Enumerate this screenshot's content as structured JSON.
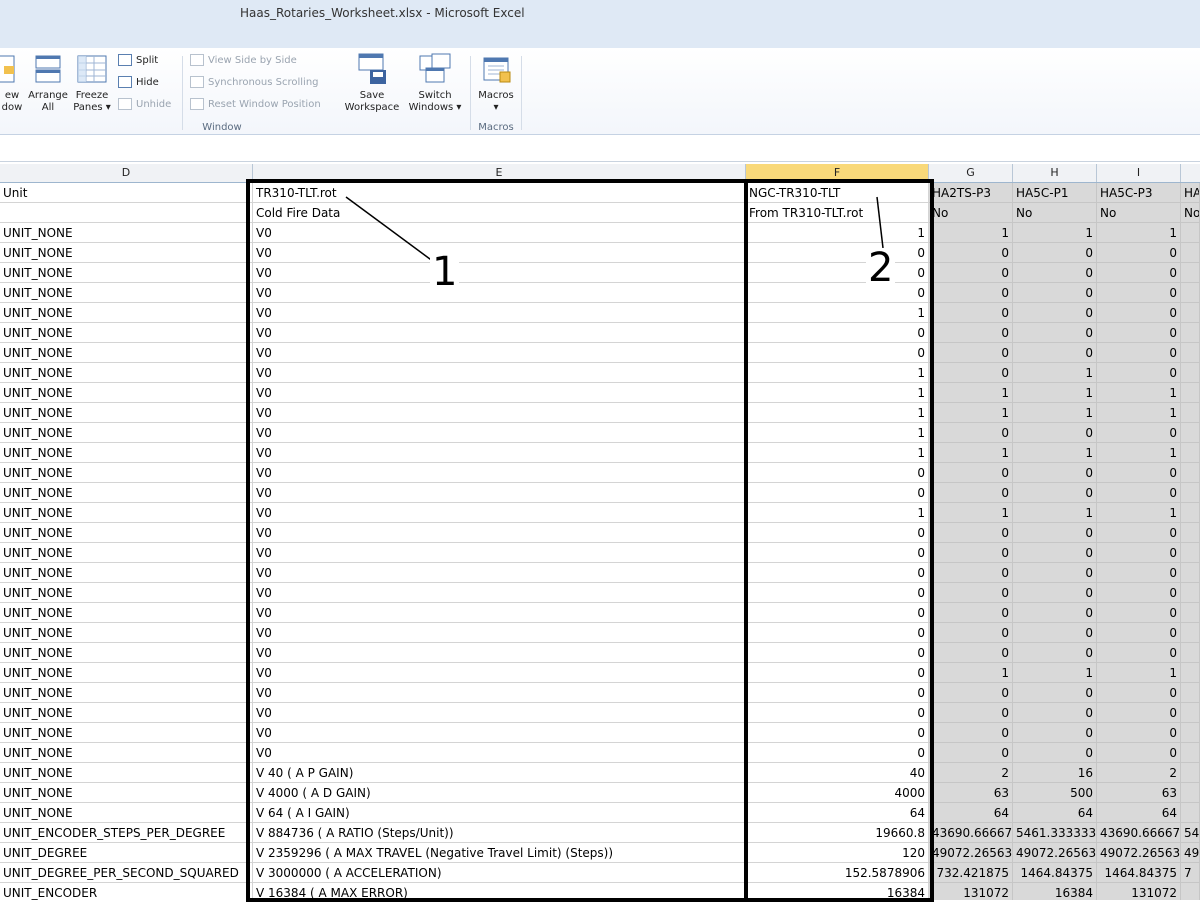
{
  "window": {
    "title": "Haas_Rotaries_Worksheet.xlsx  -  Microsoft Excel"
  },
  "ribbon": {
    "new_window": "ew\ndow",
    "arrange_all": "Arrange\nAll",
    "freeze_panes": "Freeze\nPanes ▾",
    "split": "Split",
    "hide": "Hide",
    "unhide": "Unhide",
    "view_side_by_side": "View Side by Side",
    "synchronous_scrolling": "Synchronous Scrolling",
    "reset_window_position": "Reset Window Position",
    "save_workspace": "Save\nWorkspace",
    "switch_windows": "Switch\nWindows ▾",
    "macros": "Macros",
    "macros_arrow": "▾",
    "group_window": "Window",
    "group_macros": "Macros"
  },
  "columns": [
    "D",
    "E",
    "F",
    "G",
    "H",
    "I"
  ],
  "selected_column": "F",
  "annotations": {
    "callout1": "1",
    "callout2": "2"
  },
  "header_rows": [
    {
      "d": "Unit",
      "e": "TR310-TLT.rot",
      "f": "NGC-TR310-TLT",
      "g": "HA2TS-P3",
      "h": "HA5C-P1",
      "i": "HA5C-P3",
      "j": "HA"
    },
    {
      "d": "",
      "e": "Cold Fire Data",
      "f": "From TR310-TLT.rot",
      "g": "No",
      "h": "No",
      "i": "No",
      "j": "No"
    }
  ],
  "rows": [
    {
      "d": "UNIT_NONE",
      "e": "V0",
      "f": "1",
      "g": "1",
      "h": "1",
      "i": "1"
    },
    {
      "d": "UNIT_NONE",
      "e": "V0",
      "f": "0",
      "g": "0",
      "h": "0",
      "i": "0"
    },
    {
      "d": "UNIT_NONE",
      "e": "V0",
      "f": "0",
      "g": "0",
      "h": "0",
      "i": "0"
    },
    {
      "d": "UNIT_NONE",
      "e": "V0",
      "f": "0",
      "g": "0",
      "h": "0",
      "i": "0"
    },
    {
      "d": "UNIT_NONE",
      "e": "V0",
      "f": "1",
      "g": "0",
      "h": "0",
      "i": "0"
    },
    {
      "d": "UNIT_NONE",
      "e": "V0",
      "f": "0",
      "g": "0",
      "h": "0",
      "i": "0"
    },
    {
      "d": "UNIT_NONE",
      "e": "V0",
      "f": "0",
      "g": "0",
      "h": "0",
      "i": "0"
    },
    {
      "d": "UNIT_NONE",
      "e": "V0",
      "f": "1",
      "g": "0",
      "h": "1",
      "i": "0"
    },
    {
      "d": "UNIT_NONE",
      "e": "V0",
      "f": "1",
      "g": "1",
      "h": "1",
      "i": "1"
    },
    {
      "d": "UNIT_NONE",
      "e": "V0",
      "f": "1",
      "g": "1",
      "h": "1",
      "i": "1"
    },
    {
      "d": "UNIT_NONE",
      "e": "V0",
      "f": "1",
      "g": "0",
      "h": "0",
      "i": "0"
    },
    {
      "d": "UNIT_NONE",
      "e": "V0",
      "f": "1",
      "g": "1",
      "h": "1",
      "i": "1"
    },
    {
      "d": "UNIT_NONE",
      "e": "V0",
      "f": "0",
      "g": "0",
      "h": "0",
      "i": "0"
    },
    {
      "d": "UNIT_NONE",
      "e": "V0",
      "f": "0",
      "g": "0",
      "h": "0",
      "i": "0"
    },
    {
      "d": "UNIT_NONE",
      "e": "V0",
      "f": "1",
      "g": "1",
      "h": "1",
      "i": "1"
    },
    {
      "d": "UNIT_NONE",
      "e": "V0",
      "f": "0",
      "g": "0",
      "h": "0",
      "i": "0"
    },
    {
      "d": "UNIT_NONE",
      "e": "V0",
      "f": "0",
      "g": "0",
      "h": "0",
      "i": "0"
    },
    {
      "d": "UNIT_NONE",
      "e": "V0",
      "f": "0",
      "g": "0",
      "h": "0",
      "i": "0"
    },
    {
      "d": "UNIT_NONE",
      "e": "V0",
      "f": "0",
      "g": "0",
      "h": "0",
      "i": "0"
    },
    {
      "d": "UNIT_NONE",
      "e": "V0",
      "f": "0",
      "g": "0",
      "h": "0",
      "i": "0"
    },
    {
      "d": "UNIT_NONE",
      "e": "V0",
      "f": "0",
      "g": "0",
      "h": "0",
      "i": "0"
    },
    {
      "d": "UNIT_NONE",
      "e": "V0",
      "f": "0",
      "g": "0",
      "h": "0",
      "i": "0"
    },
    {
      "d": "UNIT_NONE",
      "e": "V0",
      "f": "0",
      "g": "1",
      "h": "1",
      "i": "1"
    },
    {
      "d": "UNIT_NONE",
      "e": "V0",
      "f": "0",
      "g": "0",
      "h": "0",
      "i": "0"
    },
    {
      "d": "UNIT_NONE",
      "e": "V0",
      "f": "0",
      "g": "0",
      "h": "0",
      "i": "0"
    },
    {
      "d": "UNIT_NONE",
      "e": "V0",
      "f": "0",
      "g": "0",
      "h": "0",
      "i": "0"
    },
    {
      "d": "UNIT_NONE",
      "e": "V0",
      "f": "0",
      "g": "0",
      "h": "0",
      "i": "0"
    },
    {
      "d": "UNIT_NONE",
      "e": "V 40  ( A P GAIN)",
      "f": "40",
      "g": "2",
      "h": "16",
      "i": "2"
    },
    {
      "d": "UNIT_NONE",
      "e": "V 4000  ( A D GAIN)",
      "f": "4000",
      "g": "63",
      "h": "500",
      "i": "63"
    },
    {
      "d": "UNIT_NONE",
      "e": "V 64  ( A I GAIN)",
      "f": "64",
      "g": "64",
      "h": "64",
      "i": "64"
    },
    {
      "d": "UNIT_ENCODER_STEPS_PER_DEGREE",
      "e": "V 884736  ( A RATIO (Steps/Unit))",
      "f": "19660.8",
      "g": "43690.66667",
      "h": "5461.333333",
      "i": "43690.66667",
      "j": "54"
    },
    {
      "d": "UNIT_DEGREE",
      "e": "V 2359296  ( A MAX TRAVEL (Negative Travel Limit) (Steps))",
      "f": "120",
      "g": "49072.26563",
      "h": "49072.26563",
      "i": "49072.26563",
      "j": "49"
    },
    {
      "d": "UNIT_DEGREE_PER_SECOND_SQUARED",
      "e": "V 3000000  ( A ACCELERATION)",
      "f": "152.5878906",
      "g": "732.421875",
      "h": "1464.84375",
      "i": "1464.84375",
      "j": "7"
    },
    {
      "d": "UNIT_ENCODER",
      "e": "V 16384  ( A MAX ERROR)",
      "f": "16384",
      "g": "131072",
      "h": "16384",
      "i": "131072",
      "j": ""
    }
  ]
}
